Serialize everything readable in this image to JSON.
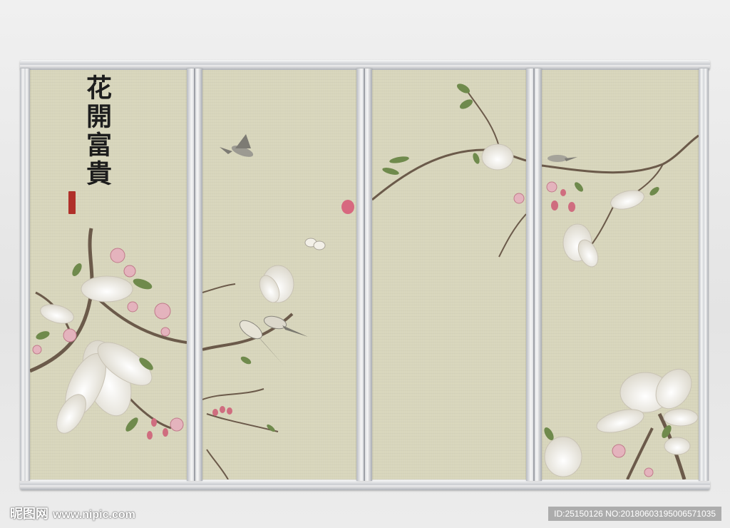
{
  "artwork": {
    "calligraphy": "花開富貴",
    "panels": [
      "panel-1",
      "panel-2",
      "panel-3",
      "panel-4"
    ],
    "colors": {
      "background": "#d8d6bc",
      "magnolia": "#f4f1ea",
      "blossom": "#d9889a",
      "branch": "#6b5a4a",
      "leaf": "#6f8a4c",
      "seal": "#b0302a",
      "frame": "#c9cbd0"
    }
  },
  "watermark": {
    "logo_text": "昵图网",
    "site_url": "www.nipic.com",
    "id_text": "ID:25150126 NO:20180603195006571035"
  }
}
